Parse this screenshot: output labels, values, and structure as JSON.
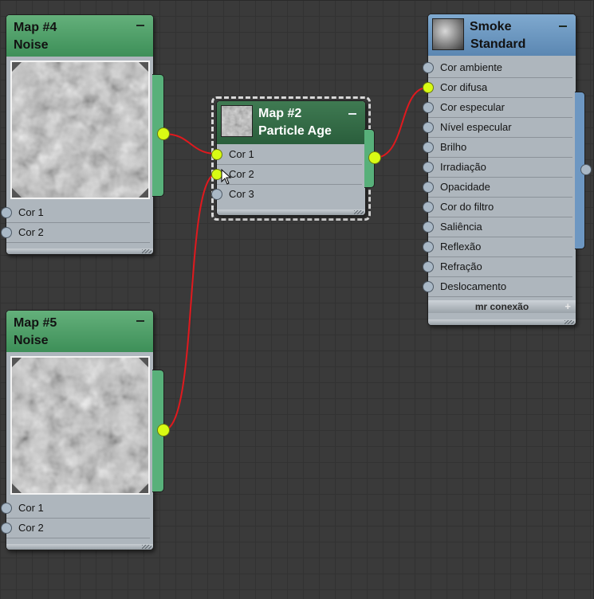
{
  "canvas": {
    "background": "#3a3a3a"
  },
  "nodes": {
    "map4": {
      "name": "Map #4",
      "type": "Noise",
      "inputs": [
        "Cor 1",
        "Cor 2"
      ]
    },
    "map5": {
      "name": "Map #5",
      "type": "Noise",
      "inputs": [
        "Cor 1",
        "Cor 2"
      ]
    },
    "map2": {
      "name": "Map #2",
      "type": "Particle Age",
      "inputs": [
        "Cor 1",
        "Cor 2",
        "Cor 3"
      ]
    },
    "smoke": {
      "name": "Smoke",
      "type": "Standard",
      "inputs": [
        "Cor ambiente",
        "Cor difusa",
        "Cor especular",
        "Nível especular",
        "Brilho",
        "Irradiação",
        "Opacidade",
        "Cor do filtro",
        "Saliência",
        "Reflexão",
        "Refração",
        "Deslocamento"
      ],
      "footer": "mr conexão",
      "footer_action": "+"
    }
  },
  "connections": [
    {
      "from": "Map #4",
      "to": "Map #2 · Cor 1"
    },
    {
      "from": "Map #5",
      "to": "Map #2 · Cor 2"
    },
    {
      "from": "Map #2",
      "to": "Smoke · Cor difusa"
    }
  ],
  "colors": {
    "noise_header": "#4ea36a",
    "particle_header": "#2f6a45",
    "material_header": "#6b97c2",
    "wire": "#e0191e",
    "socket_connected": "#d8fb14",
    "socket_idle": "#a9b8c6"
  },
  "icons": {
    "minimize": "minus-icon",
    "cursor": "arrow-cursor-icon",
    "expand": "plus-icon"
  }
}
